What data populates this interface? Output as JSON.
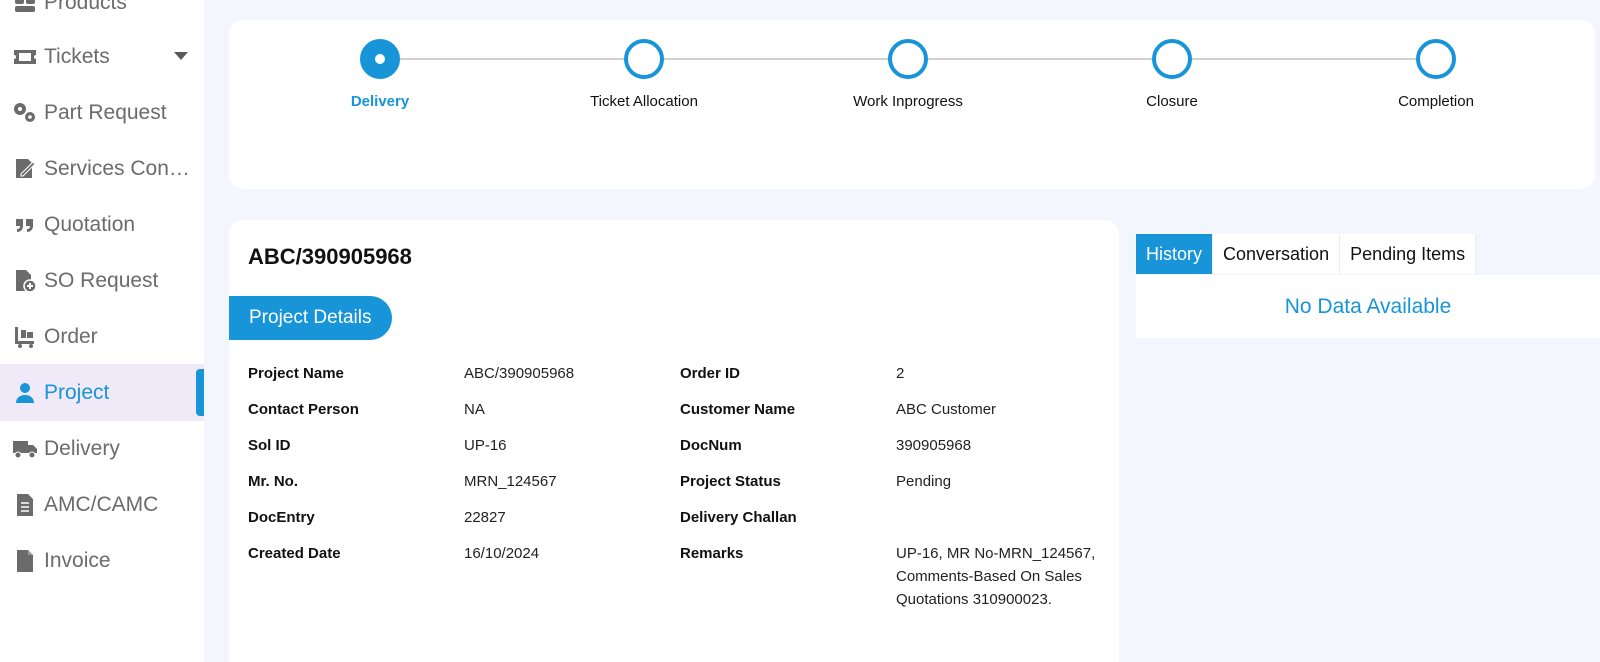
{
  "sidebar": {
    "items": [
      {
        "label": "Products",
        "icon": "products-icon"
      },
      {
        "label": "Tickets",
        "icon": "ticket-icon"
      },
      {
        "label": "Part Request",
        "icon": "gears-icon"
      },
      {
        "label": "Services Contr...",
        "icon": "contract-icon"
      },
      {
        "label": "Quotation",
        "icon": "quote-icon"
      },
      {
        "label": "SO Request",
        "icon": "file-plus-icon"
      },
      {
        "label": "Order",
        "icon": "cart-icon"
      },
      {
        "label": "Project",
        "icon": "user-icon"
      },
      {
        "label": "Delivery",
        "icon": "truck-icon"
      },
      {
        "label": "AMC/CAMC",
        "icon": "document-icon"
      },
      {
        "label": "Invoice",
        "icon": "file-icon"
      }
    ],
    "active": "Project"
  },
  "stepper": {
    "steps": [
      {
        "label": "Delivery",
        "state": "active"
      },
      {
        "label": "Ticket Allocation",
        "state": "pending"
      },
      {
        "label": "Work Inprogress",
        "state": "pending"
      },
      {
        "label": "Closure",
        "state": "pending"
      },
      {
        "label": "Completion",
        "state": "pending"
      }
    ]
  },
  "details": {
    "title": "ABC/390905968",
    "section_label": "Project Details",
    "left_fields": [
      {
        "label": "Project Name",
        "value": "ABC/390905968"
      },
      {
        "label": "Contact Person",
        "value": "NA"
      },
      {
        "label": "Sol ID",
        "value": "UP-16"
      },
      {
        "label": "Mr. No.",
        "value": "MRN_124567"
      },
      {
        "label": "DocEntry",
        "value": "22827"
      },
      {
        "label": "Created Date",
        "value": "16/10/2024"
      }
    ],
    "right_fields": [
      {
        "label": "Order ID",
        "value": "2"
      },
      {
        "label": "Customer Name",
        "value": "ABC Customer"
      },
      {
        "label": "DocNum",
        "value": "390905968"
      },
      {
        "label": "Project Status",
        "value": "Pending"
      },
      {
        "label": "Delivery Challan",
        "value": ""
      },
      {
        "label": "Remarks",
        "value": "UP-16, MR No-MRN_124567, Comments-Based On Sales Quotations 310900023."
      }
    ]
  },
  "panel": {
    "tabs": [
      "History",
      "Conversation",
      "Pending Items"
    ],
    "active_tab": "History",
    "empty_text": "No Data Available"
  },
  "colors": {
    "accent": "#1795d8",
    "active_bg": "#efe9f8",
    "page_bg": "#f3f6fd"
  }
}
